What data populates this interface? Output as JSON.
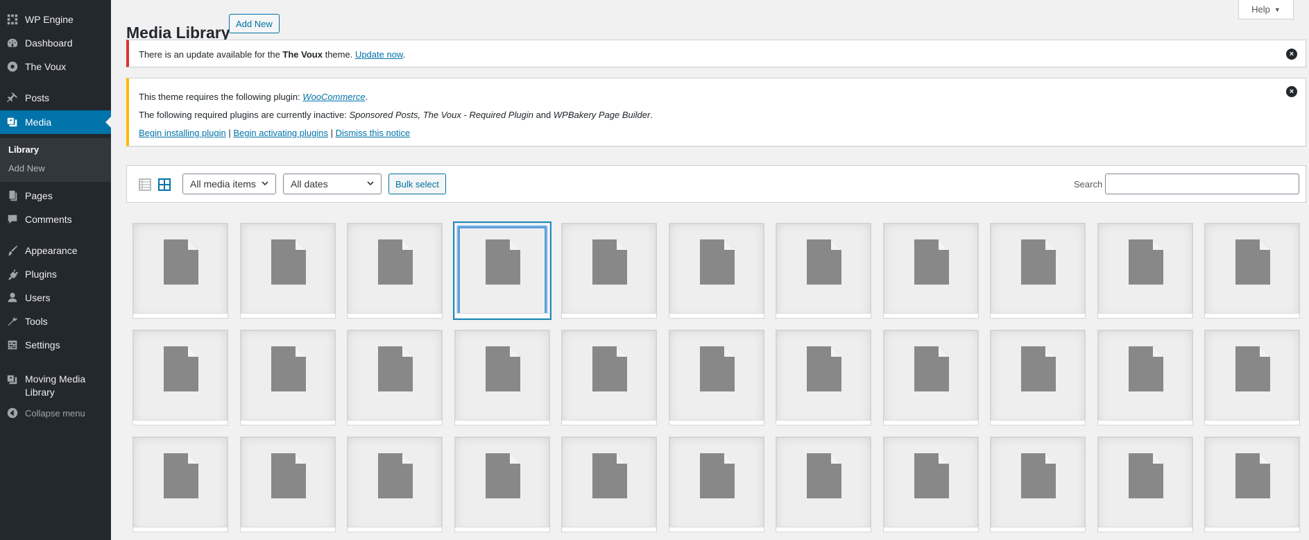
{
  "sidebar": {
    "items": [
      {
        "id": "wpengine",
        "label": "WP Engine",
        "icon": "wpengine-icon"
      },
      {
        "id": "dashboard",
        "label": "Dashboard",
        "icon": "dashboard-icon"
      },
      {
        "id": "thevoux",
        "label": "The Voux",
        "icon": "theme-icon"
      },
      {
        "id": "posts",
        "label": "Posts",
        "icon": "pushpin-icon"
      },
      {
        "id": "media",
        "label": "Media",
        "icon": "media-icon"
      },
      {
        "id": "pages",
        "label": "Pages",
        "icon": "pages-icon"
      },
      {
        "id": "comments",
        "label": "Comments",
        "icon": "comments-icon"
      },
      {
        "id": "appearance",
        "label": "Appearance",
        "icon": "paintbrush-icon"
      },
      {
        "id": "plugins",
        "label": "Plugins",
        "icon": "plugin-icon"
      },
      {
        "id": "users",
        "label": "Users",
        "icon": "users-icon"
      },
      {
        "id": "tools",
        "label": "Tools",
        "icon": "wrench-icon"
      },
      {
        "id": "settings",
        "label": "Settings",
        "icon": "settings-icon"
      },
      {
        "id": "moving",
        "label": "Moving Media Library",
        "icon": "media-icon"
      },
      {
        "id": "collapse",
        "label": "Collapse menu",
        "icon": "collapse-icon"
      }
    ],
    "submenu": [
      {
        "label": "Library",
        "current": true
      },
      {
        "label": "Add New",
        "current": false
      }
    ]
  },
  "header": {
    "title": "Media Library",
    "add_new": "Add New",
    "help": "Help"
  },
  "notices": {
    "update": {
      "text_before": "There is an update available for the ",
      "theme": "The Voux",
      "text_after": " theme. ",
      "link": "Update now",
      "end": "."
    },
    "plugins": {
      "line1_before": "This theme requires the following plugin: ",
      "line1_link": "WooCommerce",
      "line1_end": ".",
      "line2_before": "The following required plugins are currently inactive: ",
      "line2_items": "Sponsored Posts, The Voux - Required Plugin",
      "line2_and": " and ",
      "line2_last": "WPBakery Page Builder",
      "line2_end": ".",
      "link_install": "Begin installing plugin",
      "sep": " | ",
      "link_activate": "Begin activating plugins",
      "link_dismiss": "Dismiss this notice"
    }
  },
  "toolbar": {
    "filter_type": "All media items",
    "filter_date": "All dates",
    "bulk_select": "Bulk select",
    "search_label": "Search",
    "search_value": ""
  },
  "grid": {
    "rows": 3,
    "cols": 11,
    "selected_index": 3,
    "item_icon": "document-icon"
  }
}
